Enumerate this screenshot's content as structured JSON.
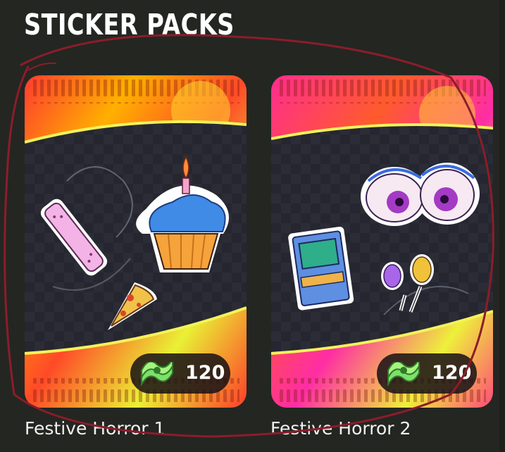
{
  "section": {
    "title": "STICKER PACKS"
  },
  "packs": [
    {
      "name": "Festive Horror 1",
      "price": "120",
      "currency_icon": "cash-icon",
      "theme_colors": [
        "#ff2f3a",
        "#ffb100",
        "#e8f23a"
      ],
      "stickers": [
        "phone-sticker-icon",
        "cupcake-sticker-icon",
        "pizza-sticker-icon"
      ]
    },
    {
      "name": "Festive Horror 2",
      "price": "120",
      "currency_icon": "cash-icon",
      "theme_colors": [
        "#ff2c9c",
        "#ff5a2a",
        "#e8f23a"
      ],
      "stickers": [
        "eyes-sticker-icon",
        "arcade-sticker-icon",
        "balloons-sticker-icon"
      ]
    }
  ],
  "colors": {
    "background": "#242622",
    "annotation": "#8b1d2a",
    "price_pill": "#19121a"
  }
}
